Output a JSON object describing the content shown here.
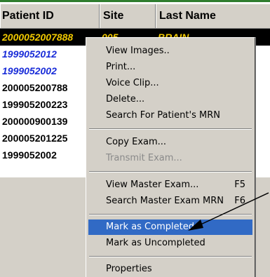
{
  "colors": {
    "top_border": "#2f7d2f",
    "selected_row_bg": "#000000",
    "selected_row_text": "#f0c800",
    "blue_text": "#1a2dd8",
    "menu_bg": "#d4d0c8",
    "menu_highlight": "#316ac5",
    "disabled_text": "#8a8a8a"
  },
  "table": {
    "headers": {
      "patient_id": "Patient ID",
      "site": "Site",
      "last_name": "Last Name"
    },
    "rows": [
      {
        "patient_id": "2000052007888",
        "site": "005",
        "last_name": "BRAIN"
      },
      {
        "patient_id": "1999052012",
        "site": "",
        "last_name": ""
      },
      {
        "patient_id": "1999052002",
        "site": "",
        "last_name": ""
      },
      {
        "patient_id": "200005200788",
        "site": "",
        "last_name": ""
      },
      {
        "patient_id": "199905200223",
        "site": "",
        "last_name": ""
      },
      {
        "patient_id": "200000900139",
        "site": "",
        "last_name": ""
      },
      {
        "patient_id": "200005201225",
        "site": "",
        "last_name": ""
      },
      {
        "patient_id": "1999052002",
        "site": "",
        "last_name": ""
      }
    ]
  },
  "context_menu": {
    "items": [
      {
        "label": "View Images..",
        "shortcut": ""
      },
      {
        "label": "Print...",
        "shortcut": ""
      },
      {
        "label": "Voice Clip...",
        "shortcut": ""
      },
      {
        "label": "Delete...",
        "shortcut": ""
      },
      {
        "label": "Search For Patient's MRN",
        "shortcut": ""
      },
      {
        "label": "Copy Exam...",
        "shortcut": ""
      },
      {
        "label": "Transmit Exam...",
        "shortcut": ""
      },
      {
        "label": "View Master Exam...",
        "shortcut": "F5"
      },
      {
        "label": "Search Master Exam MRN",
        "shortcut": "F6"
      },
      {
        "label": "Mark as Completed",
        "shortcut": ""
      },
      {
        "label": "Mark as Uncompleted",
        "shortcut": ""
      },
      {
        "label": "Properties",
        "shortcut": ""
      }
    ]
  },
  "annotation": {
    "icon": "arrow-pointer-icon"
  }
}
